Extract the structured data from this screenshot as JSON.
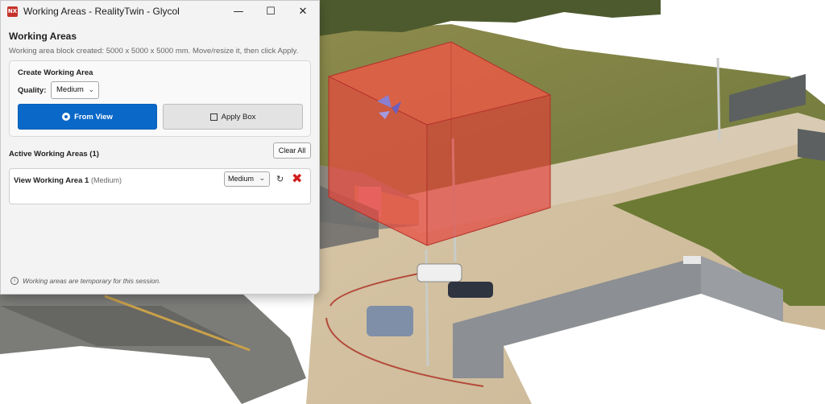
{
  "window": {
    "title": "Working Areas - RealityTwin - Glycol",
    "app_icon": "NX",
    "minimize_icon": "minimize-icon",
    "maximize_icon": "maximize-icon",
    "close_icon": "close-icon"
  },
  "panel": {
    "heading": "Working Areas",
    "status": "Working area block created: 5000 x 5000 x 5000 mm. Move/resize it, then click Apply."
  },
  "create": {
    "title": "Create Working Area",
    "quality_label": "Quality:",
    "quality_value": "Medium",
    "from_view_label": "From View",
    "apply_box_label": "Apply Box"
  },
  "active": {
    "title": "Active Working Areas (1)",
    "clear_all_label": "Clear All",
    "items": [
      {
        "name": "View Working Area 1",
        "quality_note": "(Medium)",
        "quality_value": "Medium"
      }
    ]
  },
  "footer": {
    "note": "Working areas are temporary for this session."
  },
  "colors": {
    "accent": "#0a68c8",
    "remove": "#d21f1f",
    "working_box": "#e8473a"
  }
}
